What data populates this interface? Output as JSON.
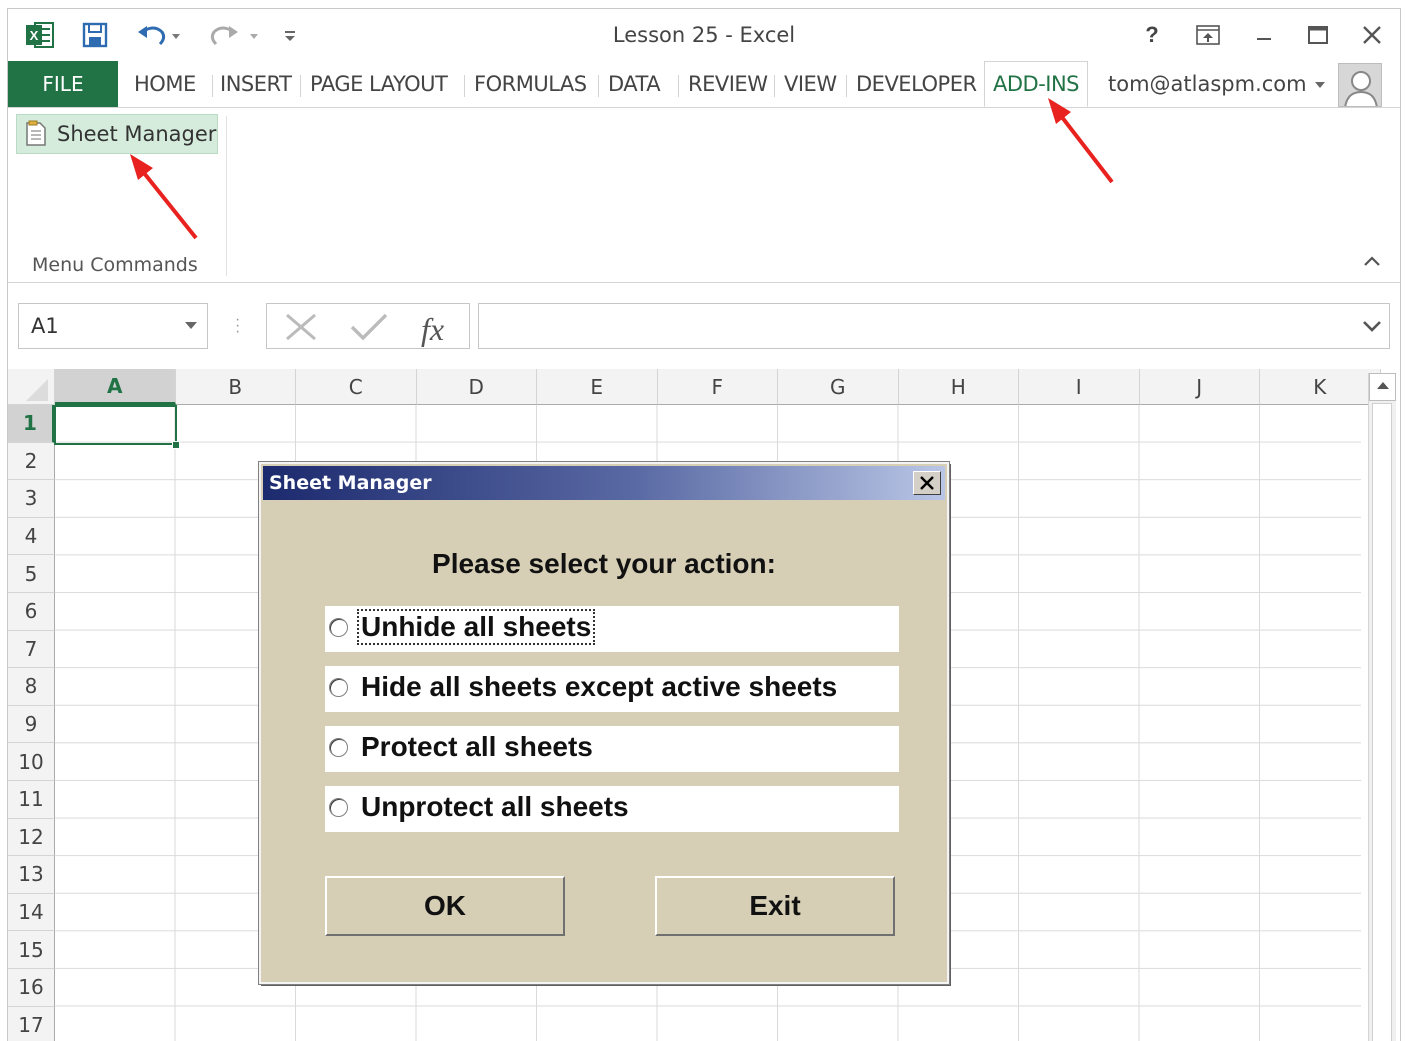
{
  "window": {
    "title": "Lesson 25 - Excel",
    "controls": [
      "?",
      "restore-ribbon",
      "minimize",
      "maximize",
      "close"
    ]
  },
  "quick_access": {
    "icons": [
      "excel-logo-icon",
      "save-icon",
      "undo-icon",
      "redo-icon",
      "customize-qat-icon"
    ]
  },
  "ribbon": {
    "file_tab": "FILE",
    "tabs": [
      "HOME",
      "INSERT",
      "PAGE LAYOUT",
      "FORMULAS",
      "DATA",
      "REVIEW",
      "VIEW",
      "DEVELOPER",
      "ADD-INS"
    ],
    "active_tab": "ADD-INS",
    "account": "tom@atlaspm.com",
    "commands": {
      "sheet_manager": "Sheet Manager",
      "group_label": "Menu Commands"
    }
  },
  "formula_bar": {
    "name_box": "A1",
    "formula": ""
  },
  "grid": {
    "columns": [
      "A",
      "B",
      "C",
      "D",
      "E",
      "F",
      "G",
      "H",
      "I",
      "J",
      "K"
    ],
    "rows": [
      "1",
      "2",
      "3",
      "4",
      "5",
      "6",
      "7",
      "8",
      "9",
      "10",
      "11",
      "12",
      "13",
      "14",
      "15",
      "16",
      "17"
    ],
    "selected_cell": "A1"
  },
  "dialog": {
    "title": "Sheet Manager",
    "prompt": "Please select your action:",
    "options": [
      "Unhide all sheets",
      "Hide all sheets except active sheets",
      "Protect all sheets",
      "Unprotect all sheets"
    ],
    "ok_label": "OK",
    "exit_label": "Exit"
  },
  "colors": {
    "excel_green": "#217346",
    "dialog_bg": "#d6cfb6",
    "annotation_arrow": "#e8231f"
  }
}
